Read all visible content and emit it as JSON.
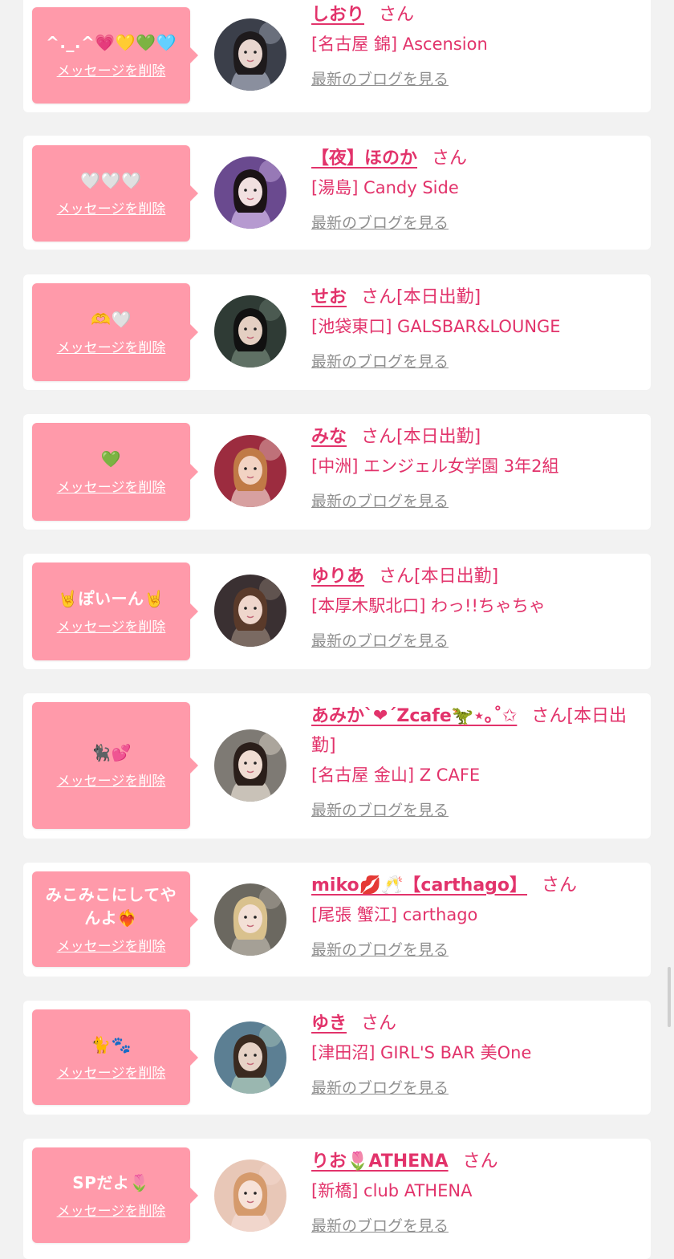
{
  "delete_label": "メッセージを削除",
  "blog_label": "最新のブログを見る",
  "san": "さん",
  "colors": {
    "bubble": "#ff9aaa",
    "accent": "#e2336b",
    "link_gray": "#8f8f8f",
    "page_bg": "#f2f2f2"
  },
  "items": [
    {
      "message": "^._.^💗💛💚🩵",
      "name": "しおり",
      "status": "",
      "shop": "[名古屋 錦] Ascension",
      "avatar": "avatar-shiori"
    },
    {
      "message": "🤍🤍🤍",
      "name": "【夜】ほのか",
      "status": "",
      "shop": "[湯島] Candy Side",
      "avatar": "avatar-honoka"
    },
    {
      "message": "🫶🤍",
      "name": "せお",
      "status": "[本日出勤]",
      "shop": "[池袋東口] GALSBAR&LOUNGE",
      "avatar": "avatar-seo"
    },
    {
      "message": "💚",
      "name": "みな",
      "status": "[本日出勤]",
      "shop": "[中洲] エンジェル女学園 3年2組",
      "avatar": "avatar-mina"
    },
    {
      "message": "🤘ぽいーん🤘",
      "name": "ゆりあ",
      "status": "[本日出勤]",
      "shop": "[本厚木駅北口] わっ!!ちゃちゃ",
      "avatar": "avatar-yuria"
    },
    {
      "message": "🐈‍⬛💕",
      "name": "あみか`❤︎´Zcafe🦖⋆｡˚✩",
      "status": "[本日出勤]",
      "shop": "[名古屋 金山] Z CAFE",
      "avatar": "avatar-amika"
    },
    {
      "message": "みこみこにしてやんよ❤️‍🔥",
      "name": "miko💋🥂【carthago】",
      "status": "",
      "shop": "[尾張 蟹江] carthago",
      "avatar": "avatar-miko"
    },
    {
      "message": "🐈🐾",
      "name": "ゆき",
      "status": "",
      "shop": "[津田沼] GIRL'S BAR 美One",
      "avatar": "avatar-yuki"
    },
    {
      "message": "SPだよ🌷",
      "name": "りお🌷ATHENA",
      "status": "",
      "shop": "[新橋] club ATHENA",
      "avatar": "avatar-rio"
    }
  ]
}
